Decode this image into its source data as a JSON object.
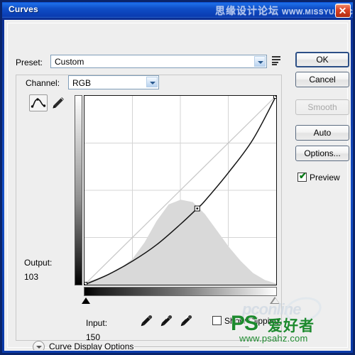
{
  "window": {
    "title": "Curves",
    "close_icon": "close-icon",
    "watermark_cn": "思缘设计论坛",
    "watermark_url": "WWW.MISSYUAN.COM"
  },
  "preset": {
    "label": "Preset:",
    "value": "Custom",
    "dropdown_icon": "chevron-down-icon",
    "menu_icon": "preset-menu-icon"
  },
  "channel": {
    "label": "Channel:",
    "value": "RGB",
    "dropdown_icon": "chevron-down-icon"
  },
  "tools": {
    "curve_icon": "curve-edit-icon",
    "pencil_icon": "pencil-icon"
  },
  "readout": {
    "output_label": "Output:",
    "output_value": "103",
    "input_label": "Input:",
    "input_value": "150"
  },
  "eyedroppers": [
    {
      "name": "set-black-point-eyedropper-icon"
    },
    {
      "name": "set-gray-point-eyedropper-icon"
    },
    {
      "name": "set-white-point-eyedropper-icon"
    }
  ],
  "show_clipping": {
    "label": "Show Clipping",
    "checked": false
  },
  "curve_display_options": {
    "label": "Curve Display Options",
    "expander_icon": "chevron-down-circle-icon",
    "expanded": false
  },
  "buttons": {
    "ok": "OK",
    "cancel": "Cancel",
    "smooth": "Smooth",
    "auto": "Auto",
    "options": "Options..."
  },
  "preview": {
    "label": "Preview",
    "checked": true,
    "check_glyph": "✔"
  },
  "colors": {
    "titlebar_blue": "#0f4fc8",
    "dialog_bg": "#eeeeee",
    "curve_stroke": "#141414",
    "diagonal_stroke": "#c8c8c8",
    "grid_stroke": "#d4d4d4",
    "histogram_fill": "#d9d9d9",
    "check_green": "#0a7a18",
    "watermark_green": "#1d8a2e"
  },
  "watermark_bottom": {
    "brand": "PS",
    "brand_cn": "爱好者",
    "url": "www.psahz.com",
    "faint": "pconline"
  },
  "chart_data": {
    "type": "line",
    "title": "Curves (RGB)",
    "xlabel": "Input",
    "ylabel": "Output",
    "xlim": [
      0,
      255
    ],
    "ylim": [
      0,
      255
    ],
    "grid": true,
    "grid_divisions": 4,
    "legend": "none",
    "series": [
      {
        "name": "baseline-diagonal",
        "comment": "identity reference line",
        "x": [
          0,
          255
        ],
        "y": [
          0,
          255
        ]
      },
      {
        "name": "tone-curve",
        "comment": "darkening curve bowed below identity; control point at Input 150 / Output 103",
        "x": [
          0,
          32,
          64,
          96,
          128,
          150,
          160,
          192,
          224,
          255
        ],
        "y": [
          0,
          14,
          32,
          54,
          82,
          103,
          113,
          152,
          196,
          255
        ]
      }
    ],
    "control_points": [
      {
        "input": 0,
        "output": 0
      },
      {
        "input": 150,
        "output": 103
      },
      {
        "input": 255,
        "output": 255
      }
    ],
    "histogram": {
      "name": "image-histogram",
      "comment": "unimodal distribution peaking near input 120",
      "bins": [
        0,
        16,
        32,
        48,
        64,
        80,
        96,
        112,
        128,
        144,
        160,
        176,
        192,
        208,
        224,
        240,
        255
      ],
      "counts": [
        2,
        5,
        9,
        14,
        22,
        36,
        54,
        68,
        72,
        70,
        60,
        46,
        32,
        20,
        10,
        4,
        1
      ]
    }
  }
}
